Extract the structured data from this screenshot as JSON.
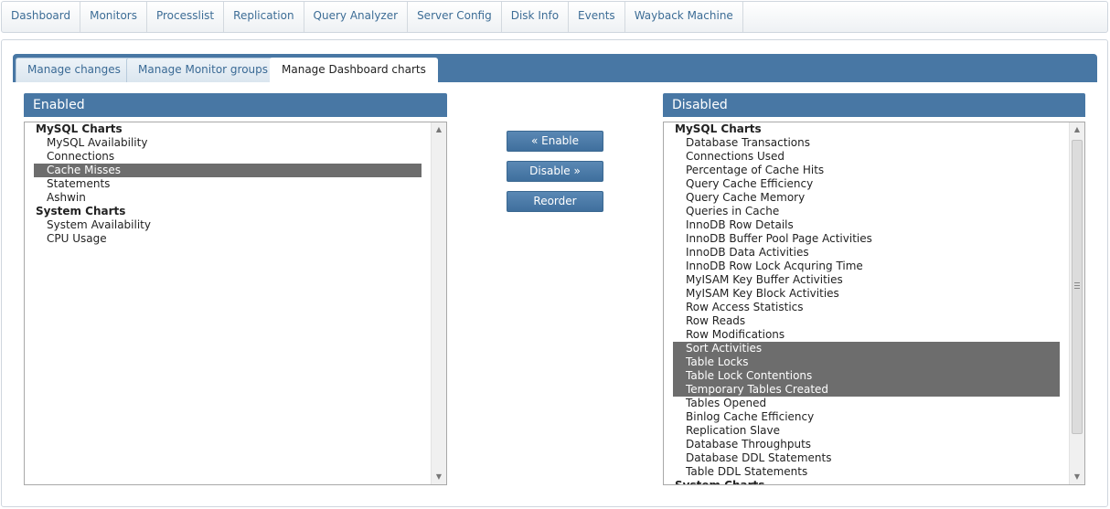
{
  "topnav": {
    "items": [
      "Dashboard",
      "Monitors",
      "Processlist",
      "Replication",
      "Query Analyzer",
      "Server Config",
      "Disk Info",
      "Events",
      "Wayback Machine"
    ]
  },
  "tabs": {
    "items": [
      "Manage changes",
      "Manage Monitor groups",
      "Manage Dashboard charts"
    ],
    "active_index": 2
  },
  "enabled": {
    "title": "Enabled",
    "groups": [
      {
        "label": "MySQL Charts",
        "options": [
          "MySQL Availability",
          "Connections",
          "Cache Misses",
          "Statements",
          "Ashwin"
        ]
      },
      {
        "label": "System Charts",
        "options": [
          "System Availability",
          "CPU Usage"
        ]
      }
    ],
    "selected": [
      "Cache Misses"
    ]
  },
  "actions": {
    "enable_label": "« Enable",
    "disable_label": "Disable »",
    "reorder_label": "Reorder"
  },
  "disabled": {
    "title": "Disabled",
    "groups": [
      {
        "label": "MySQL Charts",
        "options": [
          "Database Transactions",
          "Connections Used",
          "Percentage of Cache Hits",
          "Query Cache Efficiency",
          "Query Cache Memory",
          "Queries in Cache",
          "InnoDB Row Details",
          "InnoDB Buffer Pool Page Activities",
          "InnoDB Data Activities",
          "InnoDB Row Lock Acquring Time",
          "MyISAM Key Buffer Activities",
          "MyISAM Key Block Activities",
          "Row Access Statistics",
          "Row Reads",
          "Row Modifications",
          "Sort Activities",
          "Table Locks",
          "Table Lock Contentions",
          "Temporary Tables Created",
          "Tables Opened",
          "Binlog Cache Efficiency",
          "Replication Slave",
          "Database Throughputs",
          "Database DDL Statements",
          "Table DDL Statements"
        ]
      },
      {
        "label": "System Charts",
        "options": []
      }
    ],
    "selected": [
      "Sort Activities",
      "Table Locks",
      "Table Lock Contentions",
      "Temporary Tables Created"
    ]
  },
  "icons": {
    "scroll_up": "scroll-up-arrow-icon",
    "scroll_down": "scroll-down-arrow-icon",
    "grip": "scrollbar-grip-icon"
  },
  "colors": {
    "accent": "#4877a4",
    "selection": "#6d6d6d",
    "nav_text": "#3d6d96"
  }
}
